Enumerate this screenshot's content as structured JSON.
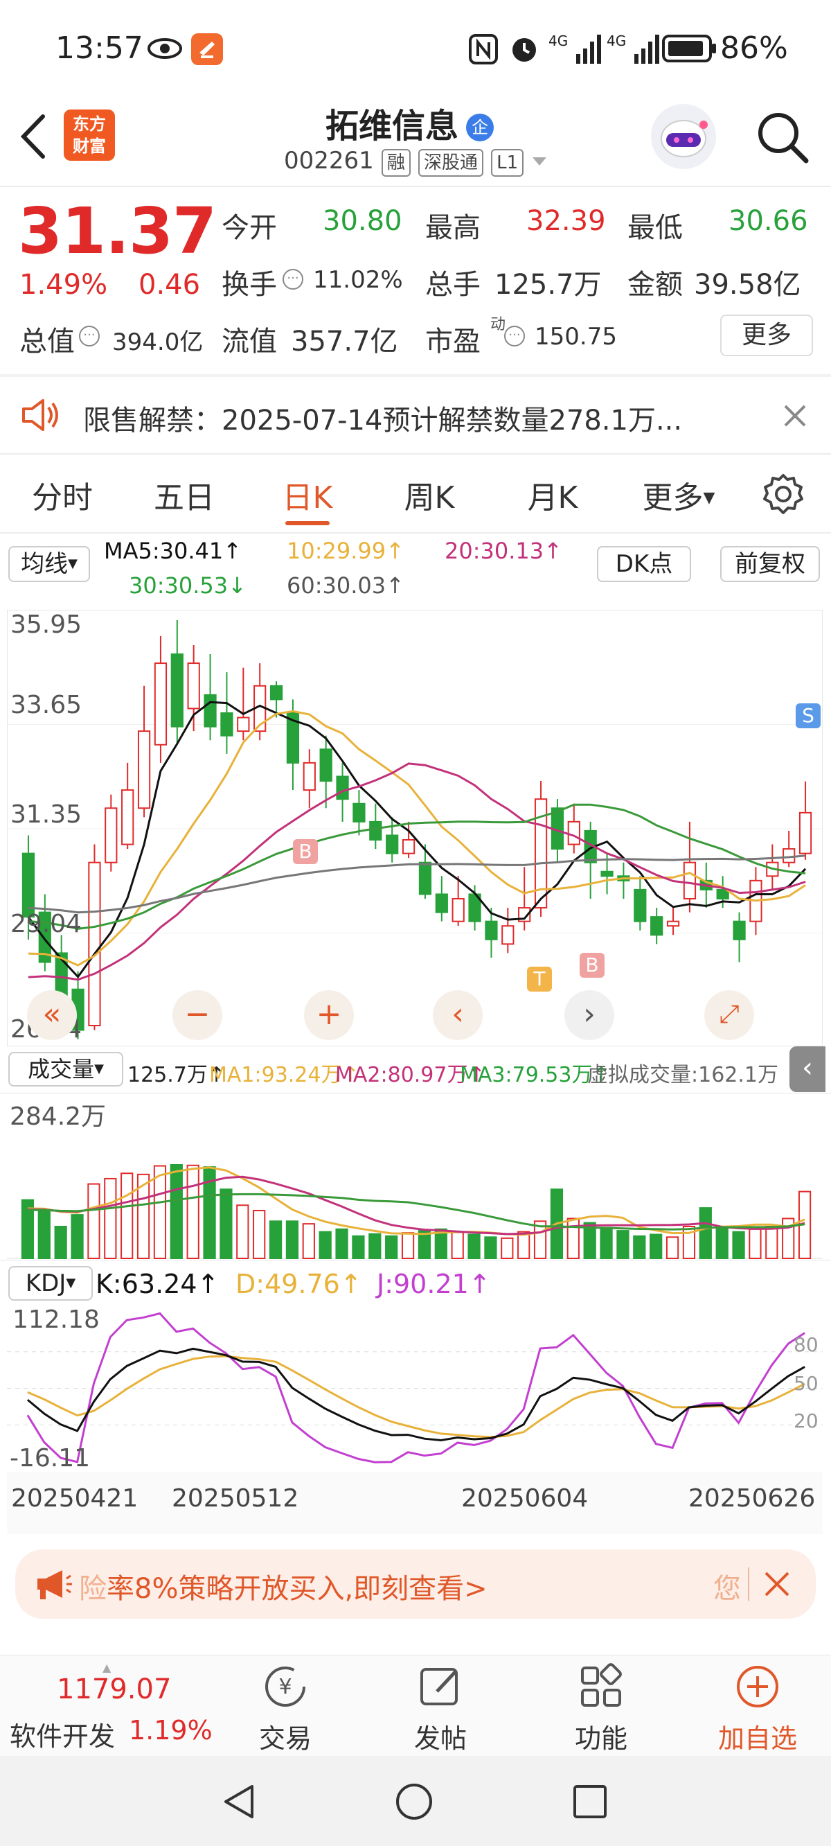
{
  "status_bar": {
    "time": "13:57",
    "battery": "86%",
    "network_1": "4G",
    "network_2": "4G"
  },
  "header": {
    "logo_line1": "东方",
    "logo_line2": "财富",
    "stock_name": "拓维信息",
    "stock_badge": "企",
    "stock_code": "002261",
    "tags": [
      "融",
      "深股通",
      "L1"
    ]
  },
  "quote": {
    "price": "31.37",
    "change_pct": "1.49%",
    "change_amt": "0.46",
    "open_label": "今开",
    "open_val": "30.80",
    "high_label": "最高",
    "high_val": "32.39",
    "low_label": "最低",
    "low_val": "30.66",
    "turnover_label": "换手",
    "turnover_val": "11.02%",
    "volume_label": "总手",
    "volume_val": "125.7万",
    "amount_label": "金额",
    "amount_val": "39.58亿",
    "mcap_label": "总值",
    "mcap_val": "394.0亿",
    "float_label": "流值",
    "float_val": "357.7亿",
    "pe_label": "市盈",
    "pe_sup": "动",
    "pe_val": "150.75",
    "more_label": "更多"
  },
  "notice": {
    "text": "限售解禁：2025-07-14预计解禁数量278.1万..."
  },
  "tabs": [
    "分时",
    "五日",
    "日K",
    "周K",
    "月K",
    "更多"
  ],
  "active_tab": 2,
  "ma_bar": {
    "selector": "均线",
    "ma5": "MA5:30.41↑",
    "ma10": "10:29.99↑",
    "ma20": "20:30.13↑",
    "ma30": "30:30.53↓",
    "ma60": "60:30.03↑",
    "dk": "DK点",
    "adjust": "前复权"
  },
  "kline": {
    "y_labels": [
      "35.95",
      "33.65",
      "31.35",
      "29.04",
      "26.74"
    ],
    "markers": [
      "B",
      "T",
      "B",
      "S"
    ]
  },
  "volume_bar": {
    "selector": "成交量",
    "value": "125.7万↑",
    "ma1": "MA1:93.24万↑",
    "ma2": "MA2:80.97万↑",
    "ma3": "MA3:79.53万↑",
    "virtual": "虚拟成交量:162.1万",
    "max_label": "284.2万"
  },
  "kdj_bar": {
    "selector": "KDJ",
    "k": "K:63.24↑",
    "d": "D:49.76↑",
    "j": "J:90.21↑",
    "y_top": "112.18",
    "y_bottom": "-16.11",
    "levels": [
      "80",
      "50",
      "20"
    ]
  },
  "dates": [
    "20250421",
    "20250512",
    "20250604",
    "20250626"
  ],
  "banner": {
    "text": "率8%策略开放买入,即刻查看>",
    "prefix": "险",
    "suffix": "您"
  },
  "bottom_nav": {
    "index_value": "1179.07",
    "index_name": "软件开发",
    "index_pct": "1.19%",
    "trade": "交易",
    "post": "发帖",
    "functions": "功能",
    "add_watch": "加自选"
  },
  "colors": {
    "up": "#e02a2a",
    "down": "#27a13a",
    "accent": "#e0582a",
    "ma5": "#111111",
    "ma10": "#e8b23a",
    "ma20": "#c2327a",
    "ma30": "#3a9a3a",
    "ma60": "#777777"
  },
  "chart_data": {
    "type": "candlestick",
    "candles": [
      [
        30.8,
        29.4,
        31.2,
        28.9
      ],
      [
        29.5,
        28.4,
        29.9,
        28.2
      ],
      [
        28.6,
        27.6,
        29.0,
        27.5
      ],
      [
        27.8,
        26.9,
        28.2,
        26.7
      ],
      [
        27.0,
        30.6,
        31.0,
        26.9
      ],
      [
        30.6,
        31.8,
        32.1,
        30.4
      ],
      [
        31.0,
        32.2,
        32.8,
        30.9
      ],
      [
        31.8,
        33.5,
        34.5,
        31.6
      ],
      [
        33.2,
        35.0,
        35.6,
        32.8
      ],
      [
        35.2,
        33.6,
        35.95,
        33.2
      ],
      [
        34.0,
        35.0,
        35.4,
        33.5
      ],
      [
        34.3,
        33.6,
        35.2,
        33.3
      ],
      [
        33.9,
        33.4,
        34.8,
        33.0
      ],
      [
        33.5,
        33.8,
        34.9,
        33.3
      ],
      [
        33.5,
        34.5,
        35.0,
        33.3
      ],
      [
        34.5,
        34.2,
        34.6,
        33.8
      ],
      [
        33.9,
        32.8,
        34.2,
        32.2
      ],
      [
        32.2,
        32.8,
        33.1,
        31.8
      ],
      [
        33.1,
        32.4,
        33.4,
        31.8
      ],
      [
        32.5,
        32.0,
        32.8,
        31.5
      ],
      [
        31.9,
        31.5,
        32.2,
        31.2
      ],
      [
        31.5,
        31.1,
        31.9,
        30.9
      ],
      [
        31.2,
        30.8,
        31.6,
        30.6
      ],
      [
        30.8,
        31.1,
        31.5,
        30.7
      ],
      [
        30.6,
        29.9,
        31.0,
        29.8
      ],
      [
        29.9,
        29.5,
        30.3,
        29.3
      ],
      [
        29.3,
        29.8,
        30.3,
        29.2
      ],
      [
        29.9,
        29.3,
        30.1,
        29.1
      ],
      [
        29.3,
        28.9,
        29.6,
        28.5
      ],
      [
        28.8,
        29.2,
        29.6,
        28.6
      ],
      [
        29.3,
        29.6,
        30.5,
        29.1
      ],
      [
        29.6,
        32.0,
        32.4,
        29.4
      ],
      [
        31.8,
        30.9,
        32.0,
        30.6
      ],
      [
        31.0,
        31.5,
        31.9,
        30.8
      ],
      [
        31.3,
        30.6,
        31.5,
        29.8
      ],
      [
        30.4,
        30.3,
        30.8,
        29.9
      ],
      [
        30.3,
        30.2,
        30.6,
        29.8
      ],
      [
        30.0,
        29.3,
        30.3,
        29.1
      ],
      [
        29.4,
        29.0,
        29.6,
        28.8
      ],
      [
        29.2,
        29.3,
        29.6,
        29.0
      ],
      [
        29.8,
        30.6,
        31.5,
        29.5
      ],
      [
        30.2,
        30.0,
        30.6,
        29.6
      ],
      [
        30.0,
        29.8,
        30.3,
        29.6
      ],
      [
        29.3,
        28.9,
        29.5,
        28.4
      ],
      [
        29.3,
        30.2,
        30.5,
        29.0
      ],
      [
        30.3,
        30.6,
        31.0,
        30.0
      ],
      [
        30.6,
        30.9,
        31.3,
        30.5
      ],
      [
        30.8,
        31.7,
        32.39,
        30.66
      ]
    ],
    "volumes": [
      110,
      88,
      60,
      82,
      140,
      150,
      160,
      158,
      174,
      176,
      175,
      172,
      130,
      100,
      90,
      70,
      70,
      65,
      50,
      55,
      42,
      46,
      42,
      48,
      52,
      55,
      50,
      45,
      40,
      38,
      50,
      70,
      130,
      75,
      67,
      58,
      52,
      42,
      45,
      40,
      60,
      95,
      58,
      50,
      55,
      60,
      75,
      125.7
    ],
    "ylim": [
      26.74,
      35.95
    ],
    "vol_max": 284.2
  }
}
